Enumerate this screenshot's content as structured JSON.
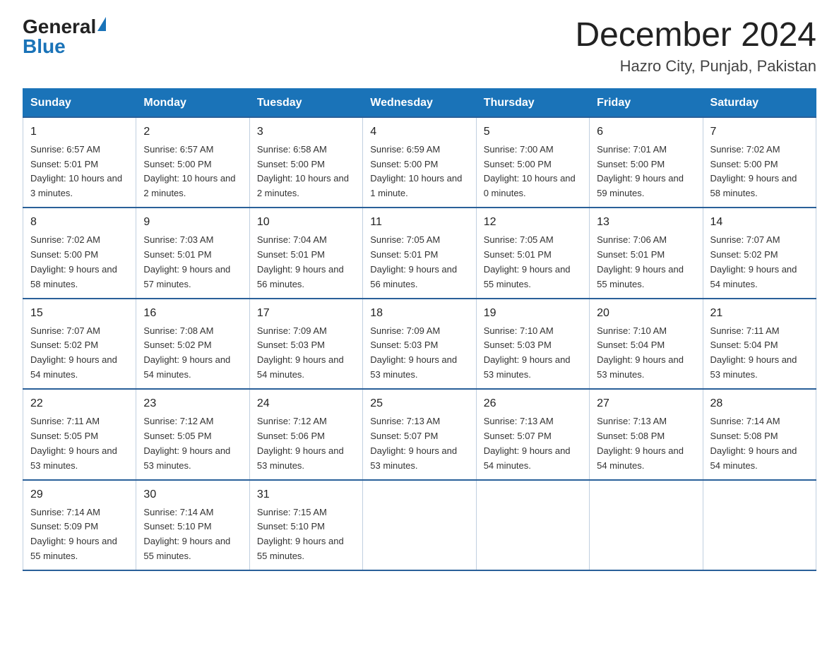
{
  "logo": {
    "line1": "General",
    "line2": "Blue"
  },
  "title": "December 2024",
  "subtitle": "Hazro City, Punjab, Pakistan",
  "days_of_week": [
    "Sunday",
    "Monday",
    "Tuesday",
    "Wednesday",
    "Thursday",
    "Friday",
    "Saturday"
  ],
  "weeks": [
    [
      {
        "date": "1",
        "sunrise": "6:57 AM",
        "sunset": "5:01 PM",
        "daylight": "10 hours and 3 minutes."
      },
      {
        "date": "2",
        "sunrise": "6:57 AM",
        "sunset": "5:00 PM",
        "daylight": "10 hours and 2 minutes."
      },
      {
        "date": "3",
        "sunrise": "6:58 AM",
        "sunset": "5:00 PM",
        "daylight": "10 hours and 2 minutes."
      },
      {
        "date": "4",
        "sunrise": "6:59 AM",
        "sunset": "5:00 PM",
        "daylight": "10 hours and 1 minute."
      },
      {
        "date": "5",
        "sunrise": "7:00 AM",
        "sunset": "5:00 PM",
        "daylight": "10 hours and 0 minutes."
      },
      {
        "date": "6",
        "sunrise": "7:01 AM",
        "sunset": "5:00 PM",
        "daylight": "9 hours and 59 minutes."
      },
      {
        "date": "7",
        "sunrise": "7:02 AM",
        "sunset": "5:00 PM",
        "daylight": "9 hours and 58 minutes."
      }
    ],
    [
      {
        "date": "8",
        "sunrise": "7:02 AM",
        "sunset": "5:00 PM",
        "daylight": "9 hours and 58 minutes."
      },
      {
        "date": "9",
        "sunrise": "7:03 AM",
        "sunset": "5:01 PM",
        "daylight": "9 hours and 57 minutes."
      },
      {
        "date": "10",
        "sunrise": "7:04 AM",
        "sunset": "5:01 PM",
        "daylight": "9 hours and 56 minutes."
      },
      {
        "date": "11",
        "sunrise": "7:05 AM",
        "sunset": "5:01 PM",
        "daylight": "9 hours and 56 minutes."
      },
      {
        "date": "12",
        "sunrise": "7:05 AM",
        "sunset": "5:01 PM",
        "daylight": "9 hours and 55 minutes."
      },
      {
        "date": "13",
        "sunrise": "7:06 AM",
        "sunset": "5:01 PM",
        "daylight": "9 hours and 55 minutes."
      },
      {
        "date": "14",
        "sunrise": "7:07 AM",
        "sunset": "5:02 PM",
        "daylight": "9 hours and 54 minutes."
      }
    ],
    [
      {
        "date": "15",
        "sunrise": "7:07 AM",
        "sunset": "5:02 PM",
        "daylight": "9 hours and 54 minutes."
      },
      {
        "date": "16",
        "sunrise": "7:08 AM",
        "sunset": "5:02 PM",
        "daylight": "9 hours and 54 minutes."
      },
      {
        "date": "17",
        "sunrise": "7:09 AM",
        "sunset": "5:03 PM",
        "daylight": "9 hours and 54 minutes."
      },
      {
        "date": "18",
        "sunrise": "7:09 AM",
        "sunset": "5:03 PM",
        "daylight": "9 hours and 53 minutes."
      },
      {
        "date": "19",
        "sunrise": "7:10 AM",
        "sunset": "5:03 PM",
        "daylight": "9 hours and 53 minutes."
      },
      {
        "date": "20",
        "sunrise": "7:10 AM",
        "sunset": "5:04 PM",
        "daylight": "9 hours and 53 minutes."
      },
      {
        "date": "21",
        "sunrise": "7:11 AM",
        "sunset": "5:04 PM",
        "daylight": "9 hours and 53 minutes."
      }
    ],
    [
      {
        "date": "22",
        "sunrise": "7:11 AM",
        "sunset": "5:05 PM",
        "daylight": "9 hours and 53 minutes."
      },
      {
        "date": "23",
        "sunrise": "7:12 AM",
        "sunset": "5:05 PM",
        "daylight": "9 hours and 53 minutes."
      },
      {
        "date": "24",
        "sunrise": "7:12 AM",
        "sunset": "5:06 PM",
        "daylight": "9 hours and 53 minutes."
      },
      {
        "date": "25",
        "sunrise": "7:13 AM",
        "sunset": "5:07 PM",
        "daylight": "9 hours and 53 minutes."
      },
      {
        "date": "26",
        "sunrise": "7:13 AM",
        "sunset": "5:07 PM",
        "daylight": "9 hours and 54 minutes."
      },
      {
        "date": "27",
        "sunrise": "7:13 AM",
        "sunset": "5:08 PM",
        "daylight": "9 hours and 54 minutes."
      },
      {
        "date": "28",
        "sunrise": "7:14 AM",
        "sunset": "5:08 PM",
        "daylight": "9 hours and 54 minutes."
      }
    ],
    [
      {
        "date": "29",
        "sunrise": "7:14 AM",
        "sunset": "5:09 PM",
        "daylight": "9 hours and 55 minutes."
      },
      {
        "date": "30",
        "sunrise": "7:14 AM",
        "sunset": "5:10 PM",
        "daylight": "9 hours and 55 minutes."
      },
      {
        "date": "31",
        "sunrise": "7:15 AM",
        "sunset": "5:10 PM",
        "daylight": "9 hours and 55 minutes."
      },
      null,
      null,
      null,
      null
    ]
  ],
  "labels": {
    "sunrise": "Sunrise:",
    "sunset": "Sunset:",
    "daylight": "Daylight:"
  }
}
